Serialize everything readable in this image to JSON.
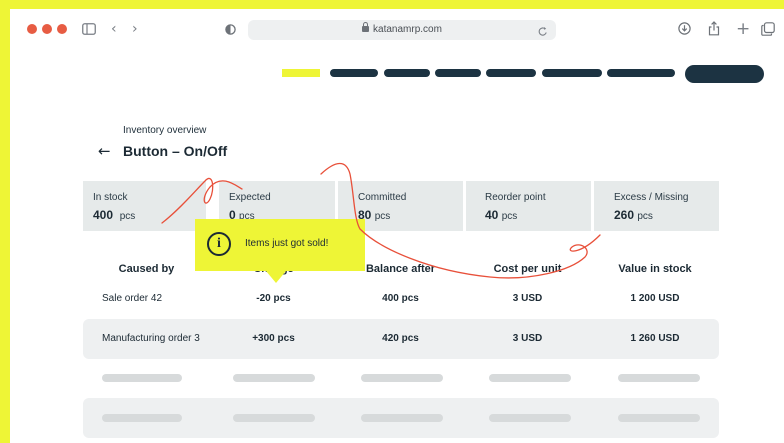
{
  "browser": {
    "url": "katanamrp.com",
    "icons": [
      "sidebar-icon",
      "back-icon",
      "forward-icon",
      "privacy-shield-icon",
      "reload-icon",
      "download-icon",
      "share-icon",
      "new-tab-icon",
      "tabs-icon"
    ]
  },
  "header": {
    "subtitle": "Inventory overview",
    "title": "Button – On/Off",
    "back_icon": "arrow-left-icon"
  },
  "stats": [
    {
      "label": "In stock",
      "value": "400",
      "unit": "pcs"
    },
    {
      "label": "Expected",
      "value": "0",
      "unit": "pcs"
    },
    {
      "label": "Committed",
      "value": "80",
      "unit": "pcs"
    },
    {
      "label": "Reorder point",
      "value": "40",
      "unit": "pcs"
    },
    {
      "label": "Excess / Missing",
      "value": "260",
      "unit": "pcs"
    }
  ],
  "table": {
    "headers": [
      "Caused by",
      "Change",
      "Balance after",
      "Cost per unit",
      "Value in stock"
    ],
    "rows": [
      [
        "Sale order 42",
        "-20 pcs",
        "400 pcs",
        "3 USD",
        "1 200 USD"
      ],
      [
        "Manufacturing order 3",
        "+300 pcs",
        "420 pcs",
        "3 USD",
        "1 260 USD"
      ]
    ]
  },
  "tooltip": {
    "text": "Items just got sold!",
    "icon": "info-icon"
  },
  "colors": {
    "accent": "#eef536",
    "nav_dark": "#1c3342",
    "annotation_red": "#e8503a",
    "card_bg": "#e6eaea"
  }
}
